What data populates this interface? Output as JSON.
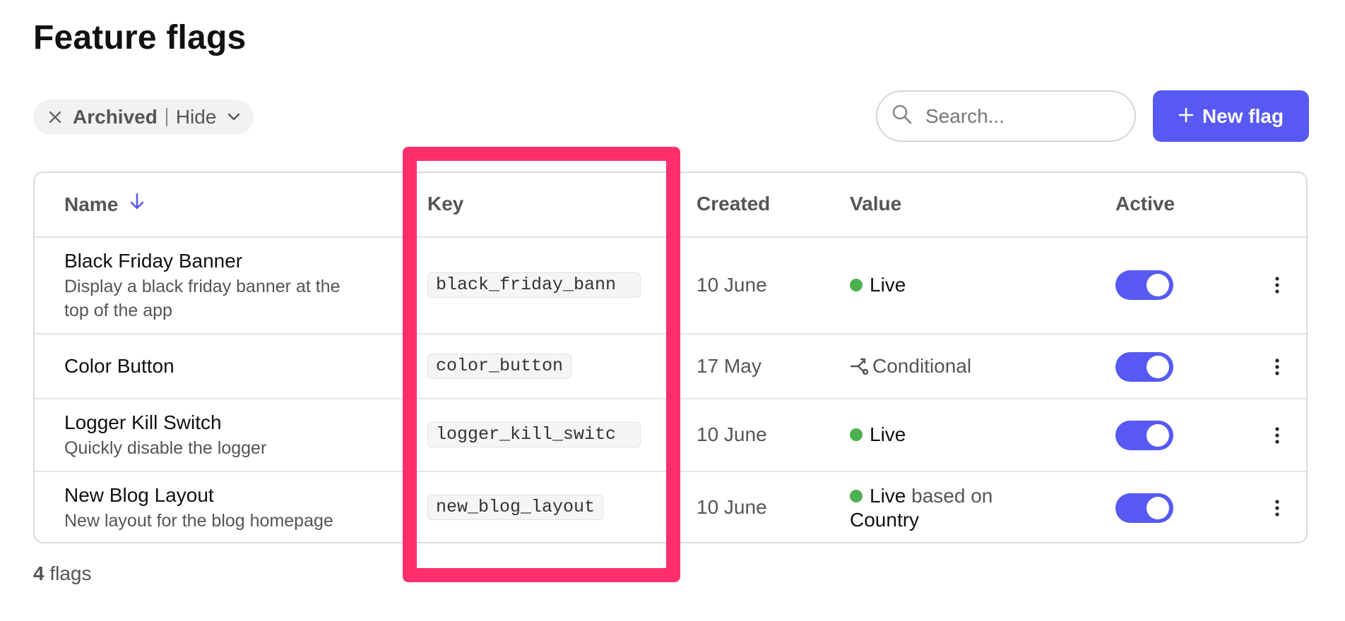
{
  "page": {
    "title": "Feature flags"
  },
  "toolbar": {
    "filter_chip": {
      "label": "Archived",
      "value": "Hide"
    },
    "search": {
      "placeholder": "Search..."
    },
    "new_button": {
      "label": "New flag"
    }
  },
  "table": {
    "columns": {
      "name": "Name",
      "key": "Key",
      "created": "Created",
      "value": "Value",
      "active": "Active"
    },
    "sort": {
      "column": "Name",
      "direction": "ascending"
    },
    "rows": [
      {
        "name": "Black Friday Banner",
        "description": "Display a black friday banner at the top of the app",
        "key": "black_friday_bann",
        "created": "10 June",
        "status": "Live",
        "status_extra": "",
        "status_extra_value": "",
        "active": true
      },
      {
        "name": "Color Button",
        "description": "",
        "key": "color_button",
        "created": "17 May",
        "status": "Conditional",
        "status_extra": "",
        "status_extra_value": "",
        "active": true
      },
      {
        "name": "Logger Kill Switch",
        "description": "Quickly disable the logger",
        "key": "logger_kill_switc",
        "created": "10 June",
        "status": "Live",
        "status_extra": "",
        "status_extra_value": "",
        "active": true
      },
      {
        "name": "New Blog Layout",
        "description": "New layout for the blog homepage",
        "key": "new_blog_layout",
        "created": "10 June",
        "status": "Live",
        "status_extra": "based on",
        "status_extra_value": "Country",
        "active": true
      }
    ]
  },
  "footer": {
    "count": "4",
    "count_label": "flags"
  },
  "colors": {
    "accent": "#5759f2",
    "live_dot": "#4caf50",
    "highlight": "#ff2f6e",
    "text": "#111111",
    "muted": "#555555"
  },
  "icons": [
    "close-icon",
    "chevron-down-icon",
    "search-icon",
    "plus-icon",
    "arrow-down-icon",
    "branch-icon",
    "more-vertical-icon"
  ]
}
